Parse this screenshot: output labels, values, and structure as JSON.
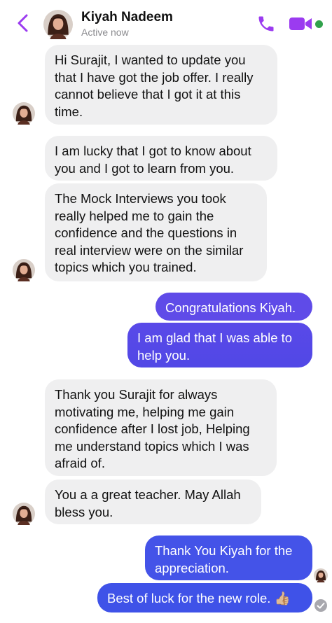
{
  "header": {
    "contact_name": "Kiyah Nadeem",
    "status": "Active now",
    "icons": [
      "chevron-left-icon",
      "avatar",
      "phone-icon",
      "video-camera-icon",
      "online-status-dot"
    ],
    "accent_color": "#9b3bf0"
  },
  "messages": [
    {
      "from": "contact",
      "text": "Hi Surajit, I wanted to update you\nthat I have got the job offer. I really\ncannot believe that I got it at this\ntime."
    },
    {
      "from": "contact",
      "text": "I am lucky that I got to know about\nyou and I got to learn from you."
    },
    {
      "from": "contact",
      "text": "The Mock Interviews you took\nreally helped me to gain the\nconfidence and the questions in\nreal interview were on the similar\ntopics which you trained."
    },
    {
      "from": "me",
      "text": "Congratulations Kiyah."
    },
    {
      "from": "me",
      "text": "I am glad that I was able to\nhelp you."
    },
    {
      "from": "contact",
      "text": "Thank you Surajit for always\nmotivating me, helping me gain\nconfidence after I lost job, Helping\nme understand topics which I was\nafraid of."
    },
    {
      "from": "contact",
      "text": "You a a great teacher. May Allah\nbless you."
    },
    {
      "from": "me",
      "text": "Thank You Kiyah for the\nappreciation."
    },
    {
      "from": "me",
      "text": "Best of luck for the new role. 👍🏼"
    }
  ],
  "colors": {
    "incoming_bubble": "#efeff0",
    "outgoing_gradient_top": "#6a4cf0",
    "outgoing_gradient_bottom": "#3f51e8",
    "online": "#31a24c"
  }
}
